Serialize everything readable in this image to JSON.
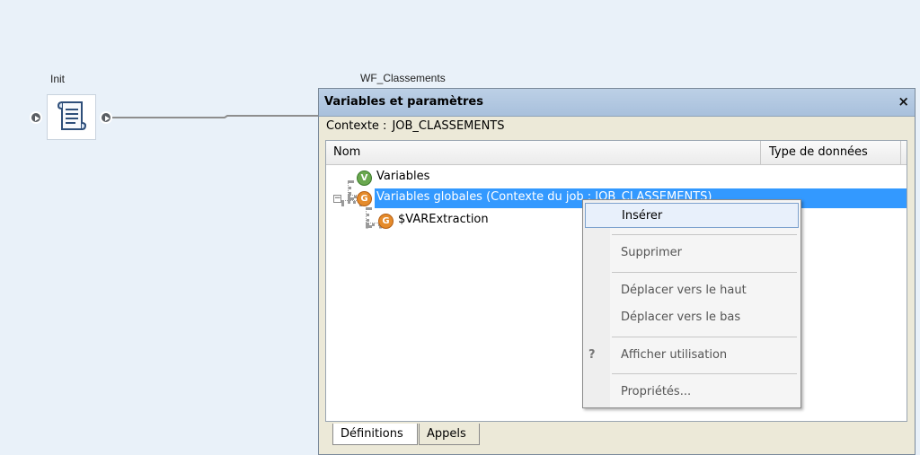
{
  "canvas": {
    "init_node": {
      "label": "Init",
      "icon": "document-scroll-icon"
    },
    "workflow_label": "WF_Classements"
  },
  "dialog": {
    "title": "Variables et paramètres",
    "close_label": "×",
    "context": {
      "label": "Contexte :",
      "value": "JOB_CLASSEMENTS"
    },
    "columns": {
      "name": "Nom",
      "data_type": "Type de données"
    },
    "tree": [
      {
        "badge": "V",
        "label": "Variables"
      },
      {
        "badge": "G",
        "label": "Variables globales (Contexte du job : JOB_CLASSEMENTS)",
        "selected": true,
        "expanded": true
      },
      {
        "badge": "G",
        "label": "$VARExtraction"
      }
    ],
    "tabs": {
      "definitions": "Définitions",
      "calls": "Appels"
    }
  },
  "context_menu": {
    "items": [
      {
        "label": "Insérer",
        "hover": true
      },
      {
        "label": "Supprimer"
      },
      {
        "label": "Déplacer vers le haut"
      },
      {
        "label": "Déplacer vers le bas"
      },
      {
        "label": "Afficher utilisation",
        "icon": "help-icon"
      },
      {
        "label": "Propriétés..."
      }
    ]
  }
}
